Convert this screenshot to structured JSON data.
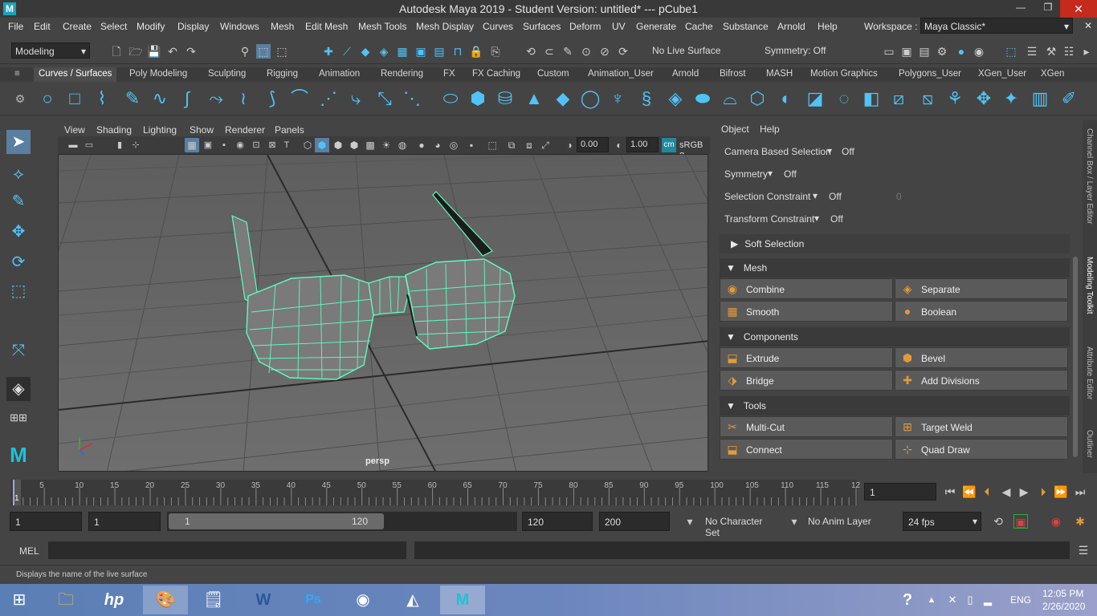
{
  "title": "Autodesk Maya 2019 - Student Version: untitled*   ---   pCube1",
  "menus": [
    "File",
    "Edit",
    "Create",
    "Select",
    "Modify",
    "Display",
    "Windows",
    "Mesh",
    "Edit Mesh",
    "Mesh Tools",
    "Mesh Display",
    "Curves",
    "Surfaces",
    "Deform",
    "UV",
    "Generate",
    "Cache",
    "Substance",
    "Arnold",
    "Help"
  ],
  "workspace": {
    "label": "Workspace :",
    "value": "Maya Classic*"
  },
  "statusline": {
    "mode": "Modeling",
    "live_surface": "No Live Surface",
    "symmetry": "Symmetry: Off"
  },
  "shelf_tabs": [
    "Curves / Surfaces",
    "Poly Modeling",
    "Sculpting",
    "Rigging",
    "Animation",
    "Rendering",
    "FX",
    "FX Caching",
    "Custom",
    "Animation_User",
    "Arnold",
    "Bifrost",
    "MASH",
    "Motion Graphics",
    "Polygons_User",
    "XGen_User",
    "XGen"
  ],
  "viewport": {
    "menus": [
      "View",
      "Shading",
      "Lighting",
      "Show",
      "Renderer",
      "Panels"
    ],
    "exposure": "0.00",
    "gamma": "1.00",
    "colorspace": "sRGB g",
    "camera": "persp"
  },
  "toolkit": {
    "menus": [
      "Object",
      "Help"
    ],
    "options": [
      {
        "label": "Camera Based Selection",
        "value": "Off"
      },
      {
        "label": "Symmetry",
        "value": "Off"
      },
      {
        "label": "Selection Constraint",
        "value": "Off",
        "extra": "0"
      },
      {
        "label": "Transform Constraint",
        "value": "Off"
      }
    ],
    "soft_selection": "Soft Selection",
    "sections": [
      {
        "title": "Mesh",
        "buttons": [
          "Combine",
          "Separate",
          "Smooth",
          "Boolean"
        ]
      },
      {
        "title": "Components",
        "buttons": [
          "Extrude",
          "Bevel",
          "Bridge",
          "Add Divisions"
        ]
      },
      {
        "title": "Tools",
        "buttons": [
          "Multi-Cut",
          "Target Weld",
          "Connect",
          "Quad Draw"
        ]
      }
    ]
  },
  "side_tabs": [
    "Channel Box / Layer Editor",
    "Modeling Toolkit",
    "Attribute Editor",
    "Outliner"
  ],
  "timeline": {
    "ticks": [
      "5",
      "10",
      "15",
      "20",
      "25",
      "30",
      "35",
      "40",
      "45",
      "50",
      "55",
      "60",
      "65",
      "70",
      "75",
      "80",
      "85",
      "90",
      "95",
      "100",
      "105",
      "110",
      "115",
      "12"
    ],
    "start": "1",
    "current": "1"
  },
  "range": {
    "start": "1",
    "playback_start": "1",
    "slider_start": "1",
    "slider_end": "120",
    "playback_end": "120",
    "end": "200",
    "character_set": "No Character Set",
    "anim_layer": "No Anim Layer",
    "fps": "24 fps"
  },
  "cmd": {
    "label": "MEL"
  },
  "help_line": "Displays the name of the live surface",
  "taskbar": {
    "lang": "ENG",
    "time": "12:05 PM",
    "date": "2/26/2020"
  },
  "colors": {
    "accent": "#4fc3f7",
    "wire": "#5dfcc0",
    "mesh": "#7a7a7a"
  }
}
